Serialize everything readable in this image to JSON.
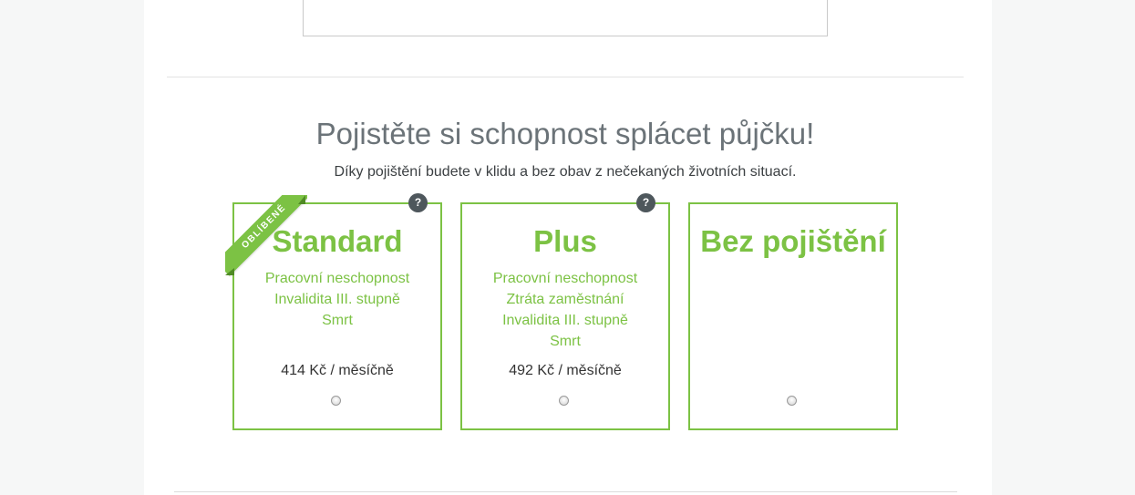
{
  "section": {
    "heading": "Pojistěte si schopnost splácet půjčku!",
    "subheading": "Díky pojištění budete v klidu a bez obav z nečekaných životních situací."
  },
  "plans": [
    {
      "title": "Standard",
      "badge": "OBLÍBENÉ",
      "help": "?",
      "features": [
        "Pracovní neschopnost",
        "Invalidita III. stupně",
        "Smrt"
      ],
      "price": "414 Kč / měsíčně"
    },
    {
      "title": "Plus",
      "help": "?",
      "features": [
        "Pracovní neschopnost",
        "Ztráta zaměstnání",
        "Invalidita III. stupně",
        "Smrt"
      ],
      "price": "492 Kč / měsíčně"
    },
    {
      "title": "Bez pojištění"
    }
  ],
  "colors": {
    "accent": "#7cc244",
    "heading": "#6b7378",
    "help_badge": "#4e575c"
  }
}
